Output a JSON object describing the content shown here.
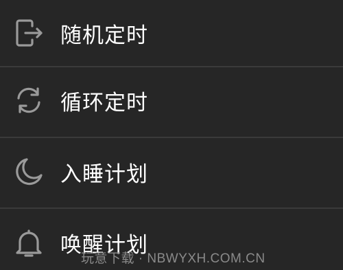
{
  "menu": {
    "items": [
      {
        "label": "随机定时",
        "icon": "exit-door-icon"
      },
      {
        "label": "循环定时",
        "icon": "refresh-cycle-icon"
      },
      {
        "label": "入睡计划",
        "icon": "moon-icon"
      },
      {
        "label": "唤醒计划",
        "icon": "bell-icon"
      }
    ]
  },
  "watermark": {
    "text": "玩意下载 · NBWYXH.COM.CN"
  },
  "colors": {
    "background": "#262626",
    "text": "#ffffff",
    "icon": "#9a9a9a",
    "divider": "#3a3a3a"
  }
}
